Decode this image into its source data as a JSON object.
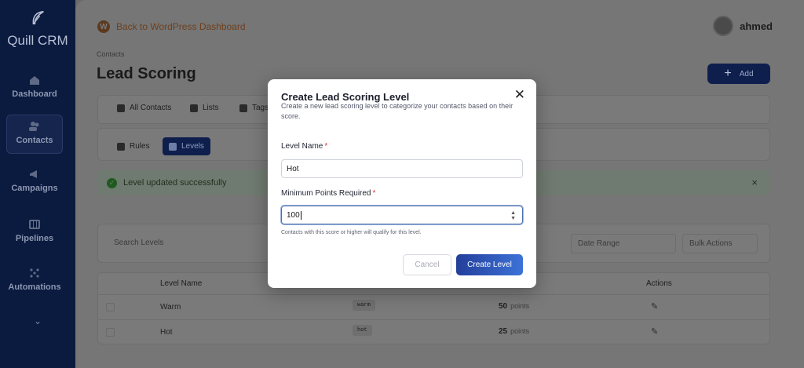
{
  "sidebar": {
    "brand": "Quill CRM",
    "items": [
      {
        "label": "Dashboard",
        "icon": "home-icon"
      },
      {
        "label": "Contacts",
        "icon": "users-icon"
      },
      {
        "label": "Campaigns",
        "icon": "megaphone-icon"
      },
      {
        "label": "Pipelines",
        "icon": "pipeline-icon"
      },
      {
        "label": "Automations",
        "icon": "nodes-icon"
      }
    ],
    "more_icon": "chevron-down-icon"
  },
  "header": {
    "back_link": "Back to WordPress Dashboard",
    "user_name": "ahmed"
  },
  "page": {
    "breadcrumb": "Contacts",
    "title": "Lead Scoring",
    "add_label": "Add"
  },
  "tabs": [
    "All Contacts",
    "Lists",
    "Tags"
  ],
  "subtabs": [
    "Rules",
    "Levels"
  ],
  "alert": {
    "message": "Level updated successfully",
    "close": "×"
  },
  "filters": {
    "search_placeholder": "Search Levels",
    "date_range": "Date Range",
    "bulk_actions": "Bulk Actions"
  },
  "table": {
    "headers": {
      "name": "Level Name",
      "actions": "Actions"
    },
    "points_unit": "points",
    "rows": [
      {
        "name": "Warm",
        "slug": "warm",
        "points": "50"
      },
      {
        "name": "Hot",
        "slug": "hot",
        "points": "25"
      }
    ]
  },
  "modal": {
    "title": "Create Lead Scoring Level",
    "subtitle": "Create a new lead scoring level to categorize your contacts based on their score.",
    "close": "✕",
    "name_label": "Level Name",
    "name_value": "Hot",
    "points_label": "Minimum Points Required",
    "points_value": "100",
    "required_mark": "*",
    "hint": "Contacts with this score or higher will qualify for this level.",
    "cancel_label": "Cancel",
    "submit_label": "Create Level"
  },
  "colors": {
    "sidebar_bg": "#0b1a3f",
    "primary": "#233f9a",
    "required": "#d33333",
    "success": "#1f5a1f"
  }
}
